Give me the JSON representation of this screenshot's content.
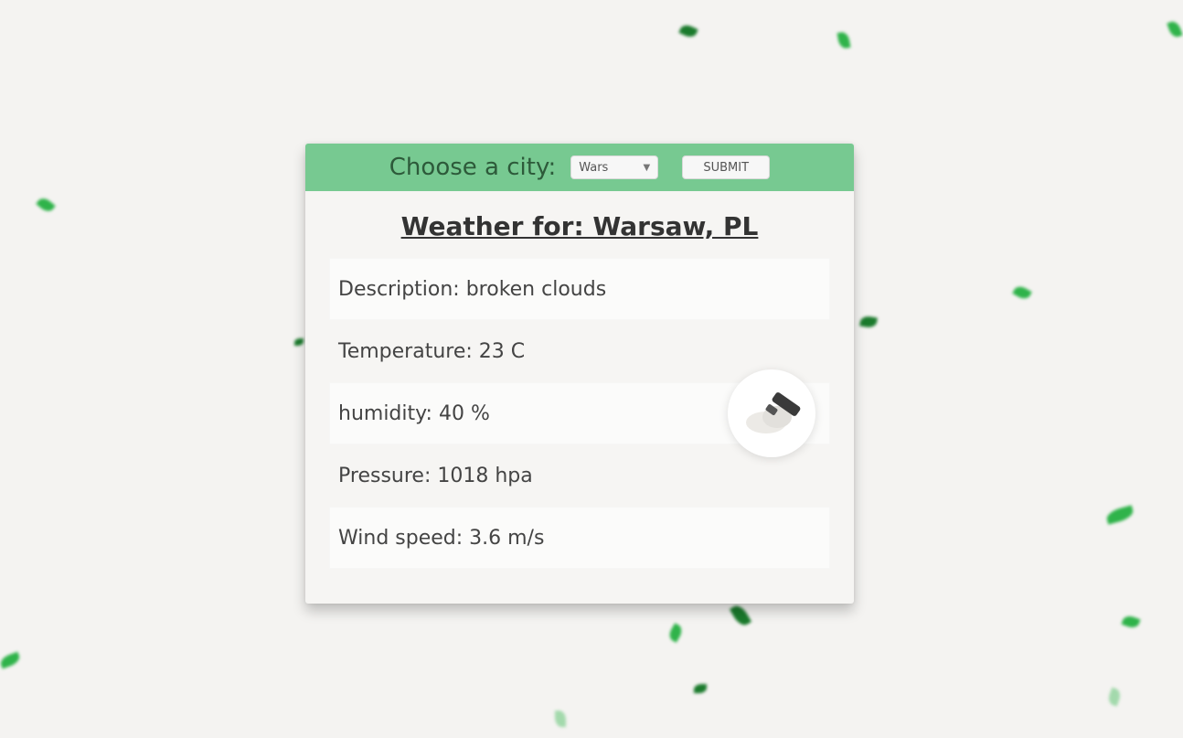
{
  "header": {
    "choose_label": "Choose a city:",
    "city_select_value": "Wars",
    "submit_label": "SUBMIT"
  },
  "weather": {
    "title": "Weather for: Warsaw, PL",
    "description": "Description: broken clouds",
    "temperature": "Temperature: 23 C",
    "humidity": "humidity: 40 %",
    "pressure": "Pressure: 1018 hpa",
    "wind_speed": "Wind speed: 3.6 m/s",
    "icon": "broken-clouds-icon"
  },
  "colors": {
    "header_bg": "#77c991",
    "page_bg": "#f4f3f1",
    "leaf_green": "#2fb34a"
  }
}
